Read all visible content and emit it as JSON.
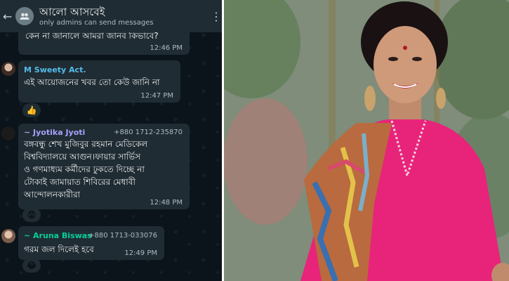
{
  "header": {
    "back_icon": "arrow-left-icon",
    "group_icon": "group-icon",
    "title": "আলো আসবেই",
    "subtitle": "only admins can send messages",
    "menu_icon": "more-vertical-icon"
  },
  "messages": [
    {
      "text": "কেন না জানালে আমরা জানব কিভাবে?",
      "time": "12:46 PM"
    },
    {
      "sender": "M Sweety Act.",
      "sender_color": "#53bdeb",
      "text": "এই আয়োজনের খবর তো কেউ জানি না",
      "time": "12:47 PM",
      "reaction": "👍"
    },
    {
      "sender": "~ Jyotika Jyoti",
      "sender_color": "#a6a1ff",
      "phone": "+880 1712-235870",
      "lines": [
        "বঙ্গবন্ধু শেখ মুজিবুর রহমান মেডিকেল",
        "বিশ্ববিদ্যালয়ে আগুন।ফায়ার সার্ভিস",
        "ও গণমাধ্যম কর্মীদের ঢুকতে দিচ্ছে না",
        "টোকাই জামায়াত শিবিরের মেধাবী",
        "আন্দোলনকারীরা"
      ],
      "time": "12:48 PM",
      "reaction": "😡"
    },
    {
      "sender": "~ Aruna Biswas",
      "sender_color": "#06cf9c",
      "phone": "+880 1713-033076",
      "text": "গরম জল দিলেই  হবে",
      "time": "12:49 PM",
      "reaction": "😂"
    }
  ],
  "colors": {
    "chat_bg": "#0b141a",
    "bubble": "#202c33",
    "header": "#1f2c33",
    "saree": "#e8237a"
  }
}
